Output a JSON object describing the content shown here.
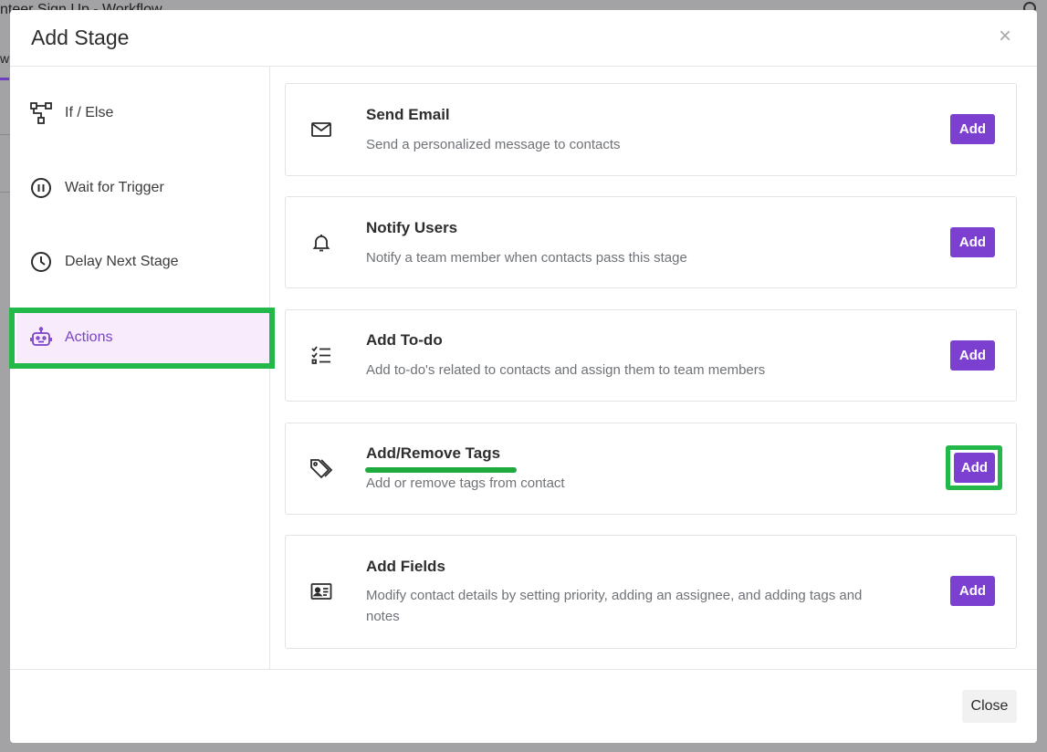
{
  "background": {
    "window_title": "nteer Sign Up - Workflow",
    "tab_fragment": "w"
  },
  "modal": {
    "title": "Add Stage",
    "close_symbol": "×",
    "sidebar": {
      "items": [
        {
          "label": "If / Else",
          "icon": "branch-icon"
        },
        {
          "label": "Wait for Trigger",
          "icon": "pause-circle-icon"
        },
        {
          "label": "Delay Next Stage",
          "icon": "clock-icon"
        },
        {
          "label": "Actions",
          "icon": "robot-icon",
          "active": true
        }
      ]
    },
    "actions": [
      {
        "title": "Send Email",
        "description": "Send a personalized message to contacts",
        "button": "Add",
        "icon": "envelope-icon"
      },
      {
        "title": "Notify Users",
        "description": "Notify a team member when contacts pass this stage",
        "button": "Add",
        "icon": "bell-icon"
      },
      {
        "title": "Add To-do",
        "description": "Add to-do's related to contacts and assign them to team members",
        "button": "Add",
        "icon": "checklist-icon"
      },
      {
        "title": "Add/Remove Tags",
        "description": "Add or remove tags from contact",
        "button": "Add",
        "icon": "tags-icon"
      },
      {
        "title": "Add Fields",
        "description": "Modify contact details by setting priority, adding an assignee, and adding tags and notes",
        "button": "Add",
        "icon": "id-card-icon"
      }
    ],
    "footer": {
      "close_label": "Close"
    }
  },
  "colors": {
    "accent": "#7b40cf",
    "highlight": "#22b94a",
    "active_bg": "#f8ecfc"
  }
}
